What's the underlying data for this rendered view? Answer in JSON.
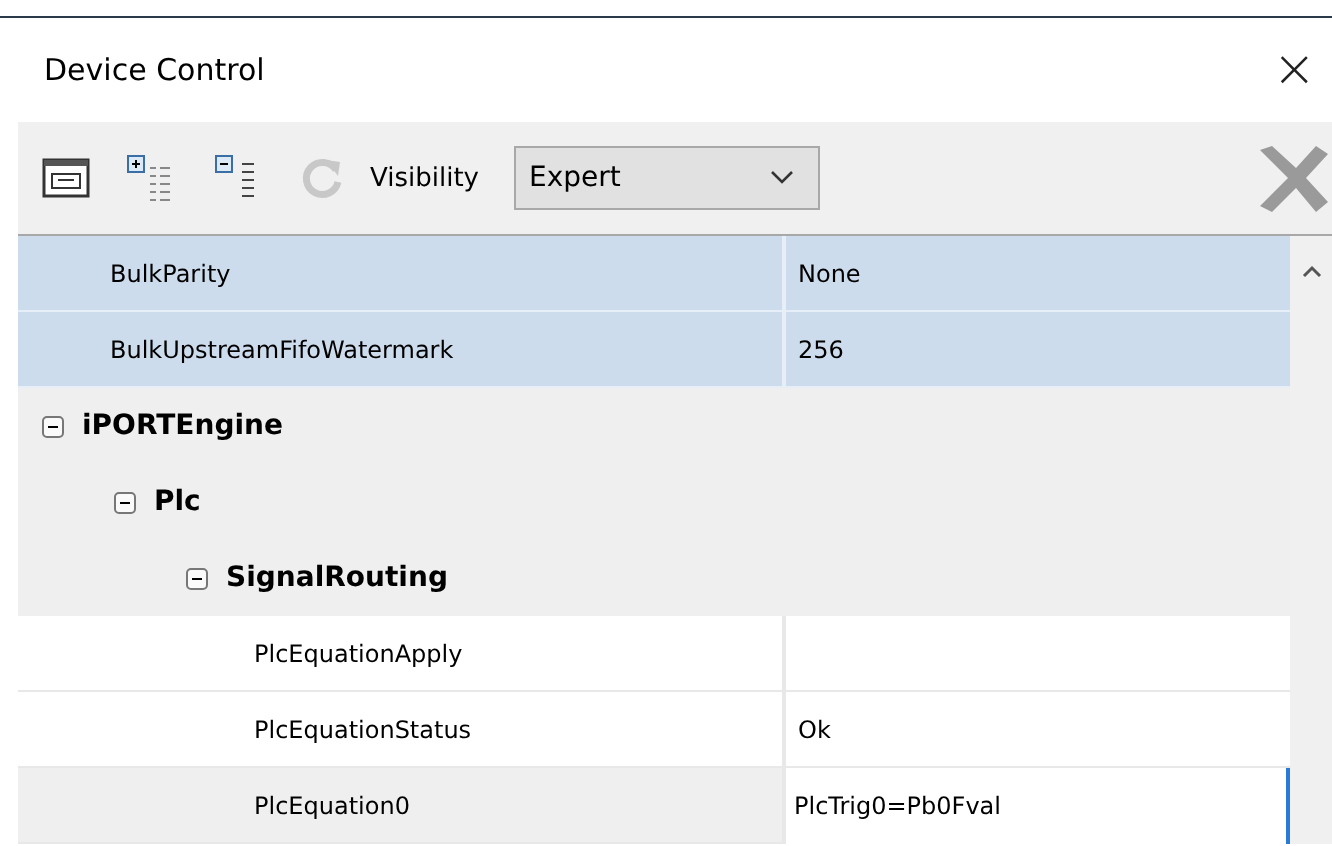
{
  "window": {
    "title": "Device Control",
    "close": "×"
  },
  "toolbar": {
    "visibility_label": "Visibility",
    "visibility_value": "Expert",
    "refresh_disabled": true,
    "delete_disabled": true
  },
  "rows": [
    {
      "kind": "property",
      "name": "BulkParity",
      "value": "None",
      "selected": true,
      "editing": false
    },
    {
      "kind": "property",
      "name": "BulkUpstreamFifoWatermark",
      "value": "256",
      "selected": true,
      "editing": false
    },
    {
      "kind": "category",
      "name": "iPORTEngine",
      "expanded": true,
      "children": [
        {
          "kind": "category",
          "name": "Plc",
          "expanded": true,
          "children": [
            {
              "kind": "category",
              "name": "SignalRouting",
              "expanded": true,
              "children": [
                {
                  "kind": "property",
                  "name": "PlcEquationApply",
                  "selected": false,
                  "editing": false
                },
                {
                  "kind": "property",
                  "name": "PlcEquationStatus",
                  "value": "Ok",
                  "selected": false,
                  "editing": false
                },
                {
                  "kind": "property",
                  "name": "PlcEquation0",
                  "value": "PlcTrig0=Pb0Fval",
                  "selected": false,
                  "editing": true
                }
              ]
            }
          ]
        }
      ]
    }
  ]
}
